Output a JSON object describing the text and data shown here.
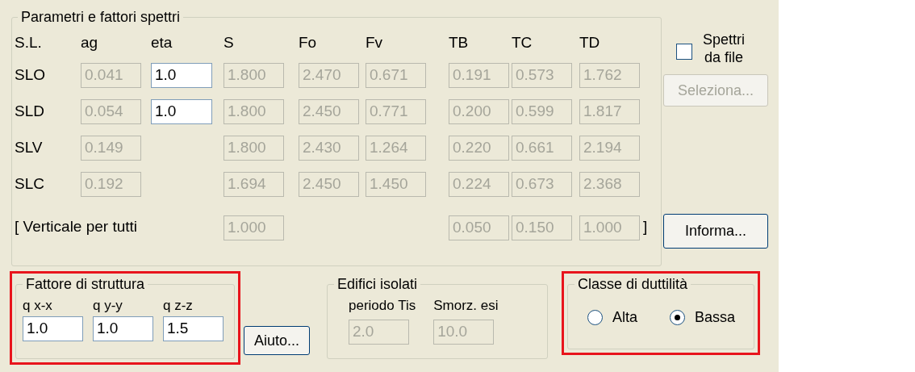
{
  "spectra": {
    "title": "Parametri e fattori spettri",
    "columns": [
      "S.L.",
      "ag",
      "eta",
      "S",
      "Fo",
      "Fv",
      "TB",
      "TC",
      "TD"
    ],
    "rows": [
      {
        "label": "SLO",
        "ag": {
          "value": "0.041",
          "disabled": true
        },
        "eta": {
          "value": "1.0",
          "disabled": false
        },
        "S": {
          "value": "1.800",
          "disabled": true
        },
        "Fo": {
          "value": "2.470",
          "disabled": true
        },
        "Fv": {
          "value": "0.671",
          "disabled": true
        },
        "TB": {
          "value": "0.191",
          "disabled": true
        },
        "TC": {
          "value": "0.573",
          "disabled": true
        },
        "TD": {
          "value": "1.762",
          "disabled": true
        }
      },
      {
        "label": "SLD",
        "ag": {
          "value": "0.054",
          "disabled": true
        },
        "eta": {
          "value": "1.0",
          "disabled": false
        },
        "S": {
          "value": "1.800",
          "disabled": true
        },
        "Fo": {
          "value": "2.450",
          "disabled": true
        },
        "Fv": {
          "value": "0.771",
          "disabled": true
        },
        "TB": {
          "value": "0.200",
          "disabled": true
        },
        "TC": {
          "value": "0.599",
          "disabled": true
        },
        "TD": {
          "value": "1.817",
          "disabled": true
        }
      },
      {
        "label": "SLV",
        "ag": {
          "value": "0.149",
          "disabled": true
        },
        "S": {
          "value": "1.800",
          "disabled": true
        },
        "Fo": {
          "value": "2.430",
          "disabled": true
        },
        "Fv": {
          "value": "1.264",
          "disabled": true
        },
        "TB": {
          "value": "0.220",
          "disabled": true
        },
        "TC": {
          "value": "0.661",
          "disabled": true
        },
        "TD": {
          "value": "2.194",
          "disabled": true
        }
      },
      {
        "label": "SLC",
        "ag": {
          "value": "0.192",
          "disabled": true
        },
        "S": {
          "value": "1.694",
          "disabled": true
        },
        "Fo": {
          "value": "2.450",
          "disabled": true
        },
        "Fv": {
          "value": "1.450",
          "disabled": true
        },
        "TB": {
          "value": "0.224",
          "disabled": true
        },
        "TC": {
          "value": "0.673",
          "disabled": true
        },
        "TD": {
          "value": "2.368",
          "disabled": true
        }
      }
    ],
    "vertical": {
      "label": "[ Verticale per tutti",
      "S": {
        "value": "1.000",
        "disabled": true
      },
      "TB": {
        "value": "0.050",
        "disabled": true
      },
      "TC": {
        "value": "0.150",
        "disabled": true
      },
      "TD": {
        "value": "1.000",
        "disabled": true
      },
      "suffix": "]"
    }
  },
  "spectra_from_file": {
    "label": "Spettri da file",
    "checked": false
  },
  "select_button": {
    "label": "Seleziona...",
    "disabled": true
  },
  "info_button": {
    "label": "Informa...",
    "disabled": false
  },
  "structure_factor": {
    "title": "Fattore di struttura",
    "highlighted": true,
    "fields": [
      {
        "label": "q x-x",
        "value": "1.0",
        "disabled": false
      },
      {
        "label": "q y-y",
        "value": "1.0",
        "disabled": false
      },
      {
        "label": "q z-z",
        "value": "1.5",
        "disabled": false
      }
    ],
    "help_button": "Aiuto..."
  },
  "isolated_buildings": {
    "title": "Edifici isolati",
    "highlighted": false,
    "fields": [
      {
        "label": "periodo Tis",
        "value": "2.0",
        "disabled": true
      },
      {
        "label": "Smorz. esi",
        "value": "10.0",
        "disabled": true
      }
    ]
  },
  "ductility_class": {
    "title": "Classe di duttilità",
    "highlighted": true,
    "options": [
      {
        "label": "Alta",
        "selected": false
      },
      {
        "label": "Bassa",
        "selected": true
      }
    ]
  }
}
